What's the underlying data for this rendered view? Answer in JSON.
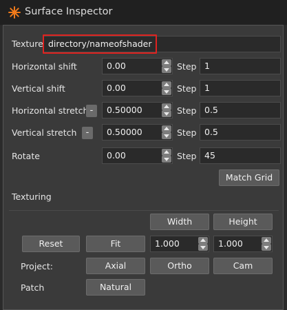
{
  "window": {
    "title": "Surface Inspector",
    "icon": "sun-orange-icon"
  },
  "texture": {
    "label": "Texture",
    "value": "directory/nameofshader"
  },
  "rows": [
    {
      "label": "Horizontal shift",
      "value": "0.00",
      "step_label": "Step",
      "step": "1"
    },
    {
      "label": "Vertical shift",
      "value": "0.00",
      "step_label": "Step",
      "step": "1"
    },
    {
      "label": "Horizontal stretch",
      "value": "0.50000",
      "step_label": "Step",
      "step": "0.5",
      "minus": "-"
    },
    {
      "label": "Vertical stretch",
      "value": "0.50000",
      "step_label": "Step",
      "step": "0.5",
      "minus": "-"
    },
    {
      "label": "Rotate",
      "value": "0.00",
      "step_label": "Step",
      "step": "45"
    }
  ],
  "match_grid": "Match Grid",
  "texturing": {
    "heading": "Texturing",
    "width_button": "Width",
    "height_button": "Height",
    "reset_button": "Reset",
    "fit_button": "Fit",
    "width_value": "1.000",
    "height_value": "1.000",
    "project_label": "Project:",
    "axial_button": "Axial",
    "ortho_button": "Ortho",
    "cam_button": "Cam",
    "patch_label": "Patch",
    "natural_button": "Natural"
  },
  "colors": {
    "accent_highlight": "#e0221f",
    "icon": "#f07a1a"
  }
}
